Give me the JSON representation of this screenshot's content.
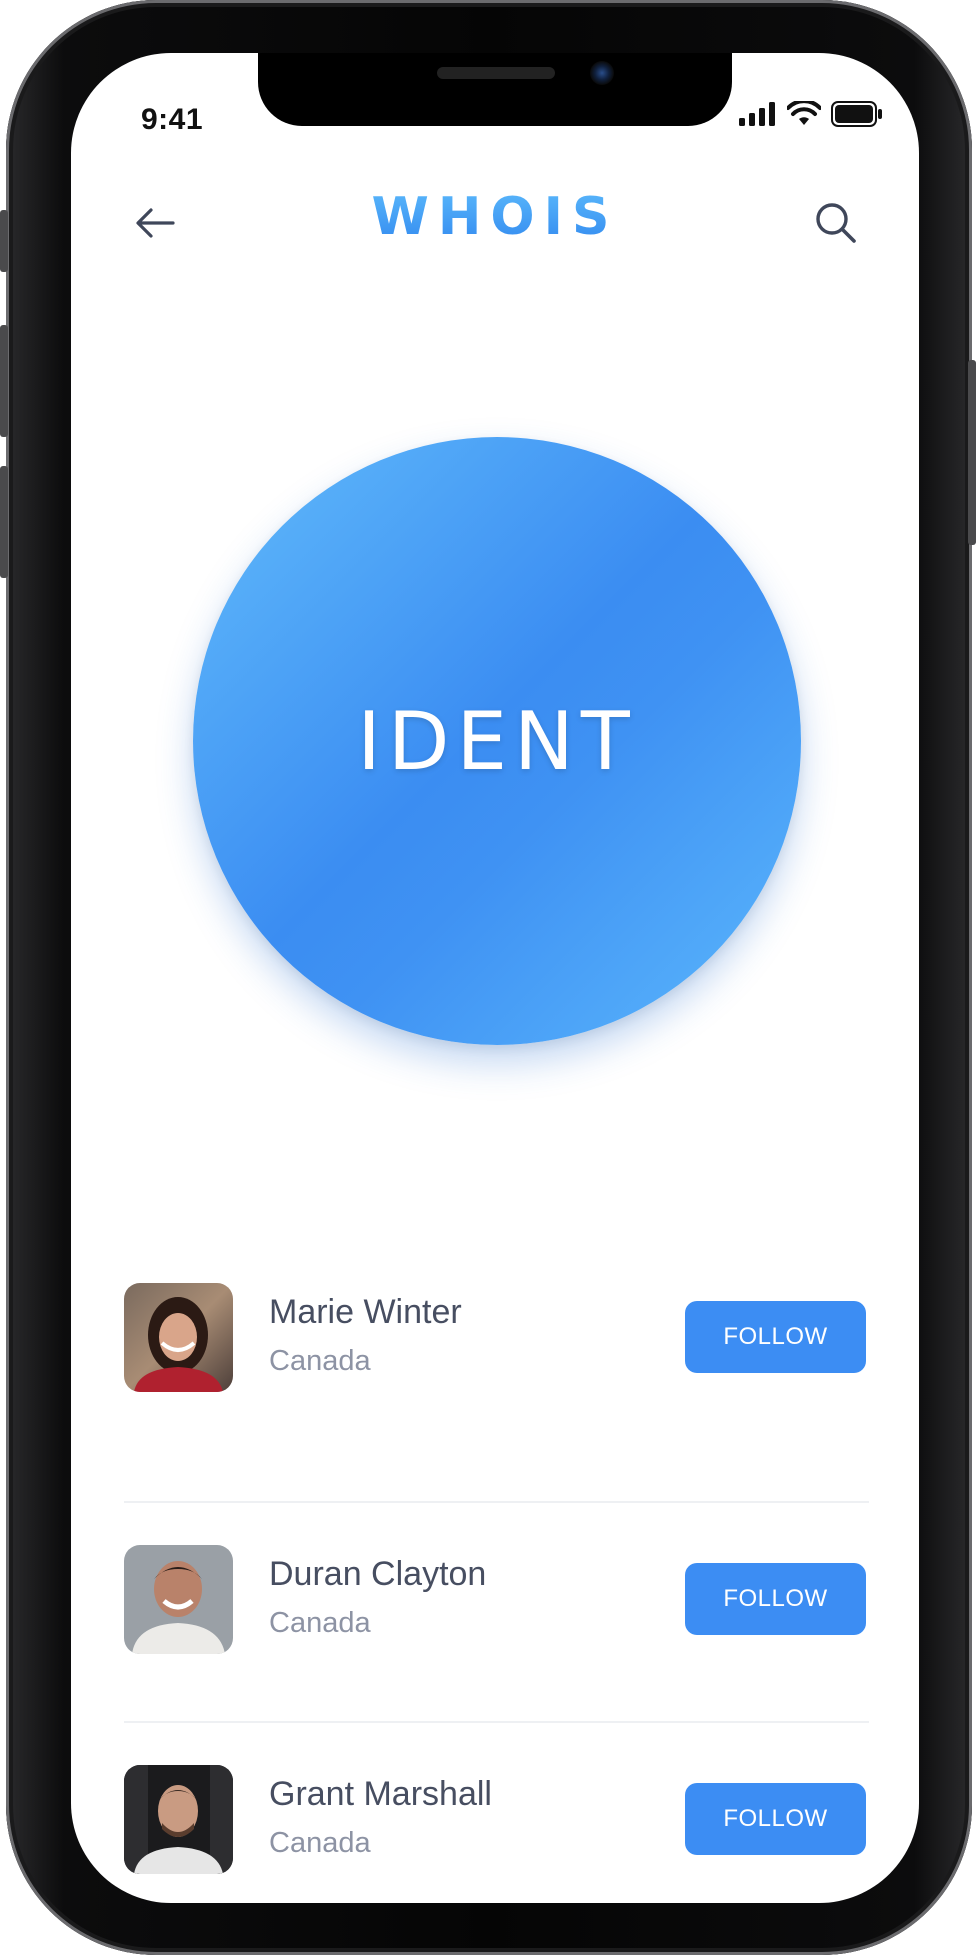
{
  "status_bar": {
    "time": "9:41"
  },
  "header": {
    "brand": "WHOIS",
    "back_icon": "arrow-left-icon",
    "search_icon": "search-icon"
  },
  "ident": {
    "label": "IDENT",
    "colors": {
      "gradient_light": "#62bcfb",
      "gradient_dark": "#3b8df2"
    }
  },
  "people": [
    {
      "name": "Marie Winter",
      "country": "Canada",
      "follow_label": "FOLLOW"
    },
    {
      "name": "Duran Clayton",
      "country": "Canada",
      "follow_label": "FOLLOW"
    },
    {
      "name": "Grant Marshall",
      "country": "Canada",
      "follow_label": "FOLLOW"
    }
  ],
  "colors": {
    "accent": "#3c8df3",
    "name_text": "#474e61",
    "secondary_text": "#8d93a4"
  }
}
